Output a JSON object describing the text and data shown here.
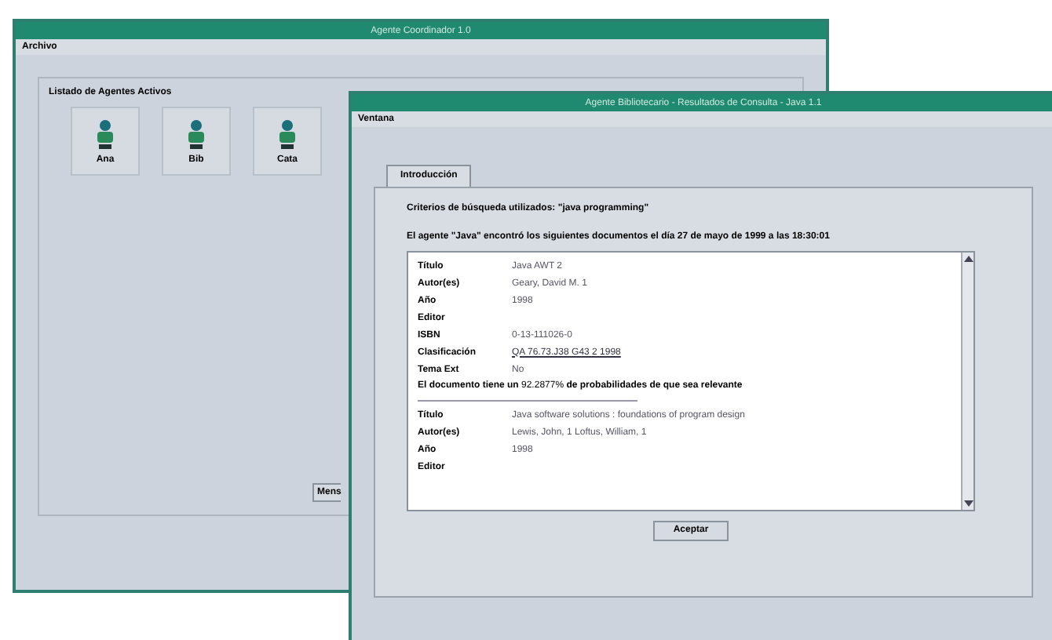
{
  "back_window": {
    "title": "Agente Coordinador 1.0",
    "menu": [
      "Archivo"
    ],
    "group_label": "Listado de Agentes Activos",
    "agents": [
      {
        "label": "Ana"
      },
      {
        "label": "Bib"
      },
      {
        "label": "Cata"
      }
    ],
    "button": "Mens"
  },
  "front_window": {
    "title": "Agente Bibliotecario - Resultados de Consulta - Java 1.1",
    "menu": [
      "Ventana"
    ],
    "tabs": [
      {
        "label": "Introducción",
        "selected": true
      }
    ],
    "query_line": "Criterios de búsqueda utilizados: \"java programming\"",
    "summary_line": "El agente \"Java\" encontró los siguientes documentos el día 27 de mayo de 1999 a las 18:30:01",
    "records": [
      {
        "fields": [
          {
            "label": "Título",
            "value": "Java AWT 2",
            "kind": "text"
          },
          {
            "label": "Autor(es)",
            "value": "Geary, David M. 1",
            "kind": "text"
          },
          {
            "label": "Año",
            "value": "1998",
            "kind": "text"
          },
          {
            "label": "Editor"
          },
          {
            "label": "ISBN",
            "value": "0-13-111026-0",
            "kind": "text"
          },
          {
            "label": "Clasificación",
            "value": "QA 76.73.J38 G43 2 1998",
            "kind": "link"
          },
          {
            "label": "Tema Ext",
            "value": "No",
            "kind": "text"
          }
        ],
        "relevance": "**El documento tiene un** 92.2877% **de probabilidades de que sea relevante**"
      },
      {
        "fields": [
          {
            "label": "Título",
            "value": "Java software solutions : foundations of program design",
            "kind": "text"
          },
          {
            "label": "Autor(es)",
            "value": "Lewis, John, 1 Loftus, William, 1",
            "kind": "text"
          },
          {
            "label": "Año",
            "value": "1998",
            "kind": "text"
          },
          {
            "label": "Editor"
          }
        ]
      }
    ],
    "button": "Aceptar"
  }
}
